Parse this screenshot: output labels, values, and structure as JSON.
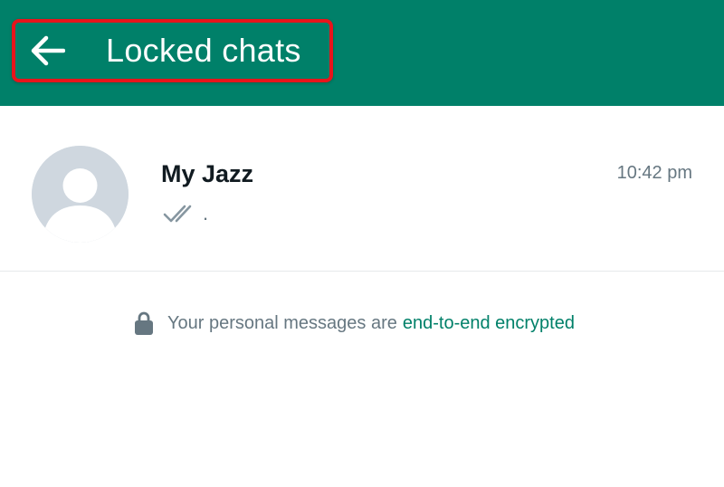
{
  "header": {
    "title": "Locked chats",
    "back_icon": "arrow-left-icon",
    "background_color": "#008069",
    "highlight_color": "#e8141b"
  },
  "chats": [
    {
      "name": "My Jazz",
      "time": "10:42 pm",
      "preview": ".",
      "status_icon": "double-check-icon",
      "avatar_icon": "default-avatar-icon"
    }
  ],
  "encryption_notice": {
    "icon": "lock-icon",
    "text": "Your personal messages are",
    "link": "end-to-end encrypted",
    "link_color": "#008069"
  }
}
